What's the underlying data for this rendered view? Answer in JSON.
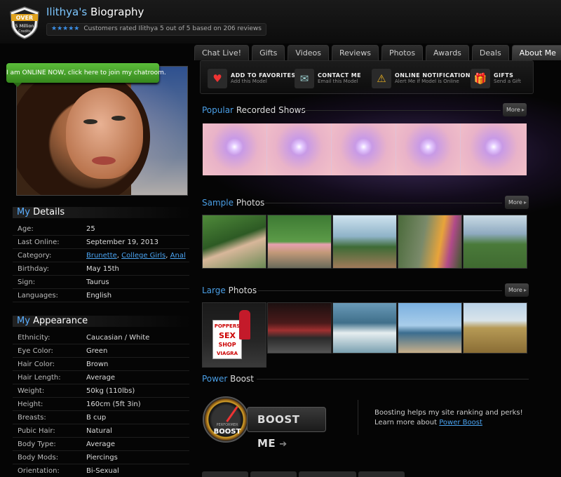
{
  "header": {
    "name": "Ilithya's",
    "title_rest": "Biography",
    "badge_top": "OVER",
    "badge_mid": "5 Million",
    "badge_bot": "Credits",
    "stars": "★★★★★",
    "rating_text": "Customers rated Ilithya 5 out of 5 based on 206 reviews"
  },
  "tabs": [
    "Chat Live!",
    "Gifts",
    "Videos",
    "Reviews",
    "Photos",
    "Awards",
    "Deals",
    "About Me"
  ],
  "online_banner": "I am ONLINE NOW, click here to join my chatroom.",
  "details": {
    "heading_accent": "My",
    "heading_rest": "Details",
    "rows": [
      {
        "k": "Age:",
        "v": "25"
      },
      {
        "k": "Last Online:",
        "v": "September 19, 2013"
      },
      {
        "k": "Category:",
        "links": [
          "Brunette",
          "College Girls",
          "Anal"
        ]
      },
      {
        "k": "Birthday:",
        "v": "May 15th"
      },
      {
        "k": "Sign:",
        "v": "Taurus"
      },
      {
        "k": "Languages:",
        "v": "English"
      }
    ]
  },
  "appearance": {
    "heading_accent": "My",
    "heading_rest": "Appearance",
    "rows": [
      {
        "k": "Ethnicity:",
        "v": "Caucasian / White"
      },
      {
        "k": "Eye Color:",
        "v": "Green"
      },
      {
        "k": "Hair Color:",
        "v": "Brown"
      },
      {
        "k": "Hair Length:",
        "v": "Average"
      },
      {
        "k": "Weight:",
        "v": "50kg (110lbs)"
      },
      {
        "k": "Height:",
        "v": "160cm (5ft 3in)"
      },
      {
        "k": "Breasts:",
        "v": "B cup"
      },
      {
        "k": "Pubic Hair:",
        "v": "Natural"
      },
      {
        "k": "Body Type:",
        "v": "Average"
      },
      {
        "k": "Body Mods:",
        "v": "Piercings"
      },
      {
        "k": "Orientation:",
        "v": "Bi-Sexual"
      }
    ]
  },
  "actions": [
    {
      "title": "ADD TO FAVORITES",
      "sub": "Add this Model",
      "icon": "heart-icon"
    },
    {
      "title": "CONTACT ME",
      "sub": "Email this Model",
      "icon": "mail-icon"
    },
    {
      "title": "ONLINE NOTIFICATION",
      "sub": "Alert Me if Model is Online",
      "icon": "alert-icon"
    },
    {
      "title": "GIFTS",
      "sub": "Send a Gift",
      "icon": "gift-icon"
    }
  ],
  "sections": {
    "shows": {
      "accent": "Popular",
      "rest": "Recorded Shows"
    },
    "sample": {
      "accent": "Sample",
      "rest": "Photos"
    },
    "large": {
      "accent": "Large",
      "rest": "Photos"
    },
    "boost": {
      "accent": "Power",
      "rest": "Boost"
    }
  },
  "more_label": "More",
  "poster_text": [
    "POPPERS",
    "SEX",
    "SHOP",
    "VIAGRA"
  ],
  "boost": {
    "gauge_top": "PERFORMER",
    "gauge_bottom": "BOOST",
    "button": "BOOST ME",
    "line1": "Boosting helps my site ranking and perks!",
    "line2_prefix": "Learn more about",
    "link": "Power Boost"
  }
}
